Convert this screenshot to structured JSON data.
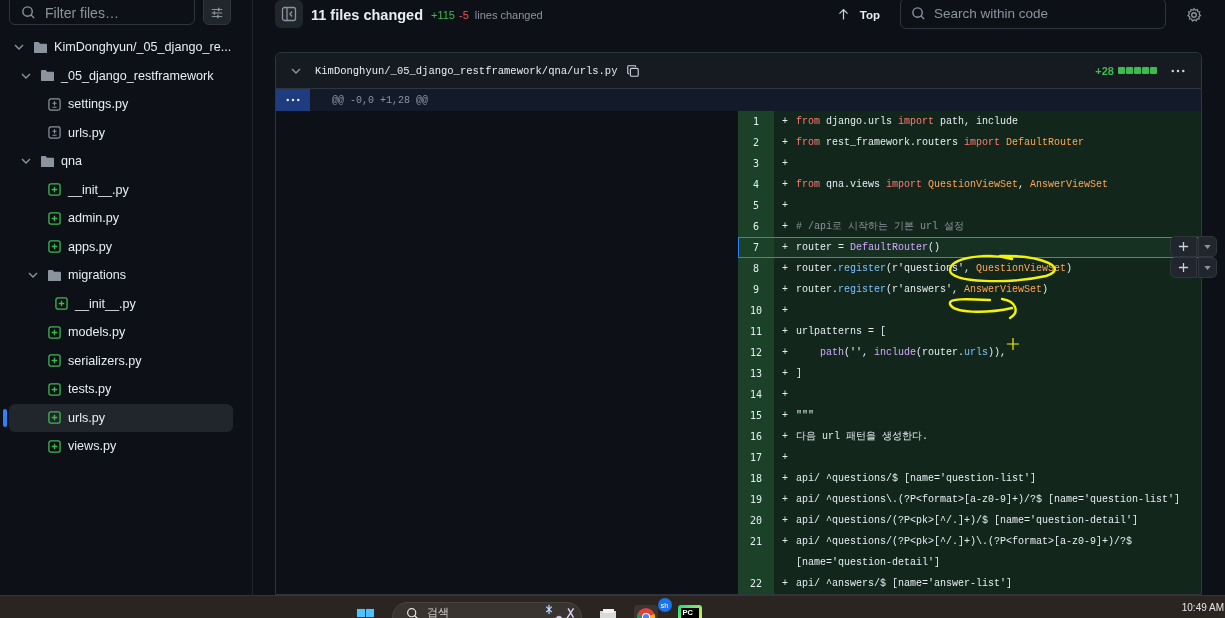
{
  "sidebar": {
    "filter_placeholder": "Filter files…",
    "tree": [
      {
        "kind": "folder",
        "name": "KimDonghyun/_05_django_re...",
        "expanded": true,
        "selected": false,
        "children": [
          {
            "kind": "folder",
            "name": "_05_django_restframework",
            "expanded": true,
            "selected": false,
            "children": [
              {
                "kind": "modified_file",
                "name": "settings.py",
                "selected": false
              },
              {
                "kind": "modified_file",
                "name": "urls.py",
                "selected": false
              }
            ]
          },
          {
            "kind": "folder",
            "name": "qna",
            "expanded": true,
            "selected": false,
            "children": [
              {
                "kind": "added_file",
                "name": "__init__.py",
                "selected": false
              },
              {
                "kind": "added_file",
                "name": "admin.py",
                "selected": false
              },
              {
                "kind": "added_file",
                "name": "apps.py",
                "selected": false
              },
              {
                "kind": "folder",
                "name": "migrations",
                "expanded": true,
                "selected": false,
                "children": [
                  {
                    "kind": "added_file",
                    "name": "__init__.py",
                    "selected": false
                  }
                ]
              },
              {
                "kind": "added_file",
                "name": "models.py",
                "selected": false
              },
              {
                "kind": "added_file",
                "name": "serializers.py",
                "selected": false
              },
              {
                "kind": "added_file",
                "name": "tests.py",
                "selected": false
              },
              {
                "kind": "added_file",
                "name": "urls.py",
                "selected": true
              },
              {
                "kind": "added_file",
                "name": "views.py",
                "selected": false
              }
            ]
          }
        ]
      }
    ]
  },
  "header": {
    "title": "11 files changed",
    "additions": "+115",
    "deletions": "-5",
    "note": "lines changed",
    "top_label": "Top",
    "search_placeholder": "Search within code"
  },
  "file": {
    "path": "KimDonghyun/_05_django_restframework/qna/urls.py",
    "expanded": true,
    "additions": "+28",
    "hunk": "@@ -0,0 +1,28 @@",
    "lines": [
      {
        "number": "1",
        "kind": "add",
        "marker": "+",
        "selected": false,
        "comment_button": false,
        "tokens": [
          {
            "kind": "kw",
            "text": "from"
          },
          {
            "kind": "txt",
            "text": " django.urls "
          },
          {
            "kind": "kw",
            "text": "import"
          },
          {
            "kind": "txt",
            "text": " path, include"
          }
        ]
      },
      {
        "number": "2",
        "kind": "add",
        "marker": "+",
        "selected": false,
        "comment_button": false,
        "tokens": [
          {
            "kind": "kw",
            "text": "from"
          },
          {
            "kind": "txt",
            "text": " rest_framework.routers "
          },
          {
            "kind": "kw",
            "text": "import"
          },
          {
            "kind": "cls",
            "text": " DefaultRouter"
          }
        ]
      },
      {
        "number": "3",
        "kind": "add",
        "marker": "+",
        "selected": false,
        "comment_button": false
      },
      {
        "number": "4",
        "kind": "add",
        "marker": "+",
        "selected": false,
        "comment_button": false,
        "tokens": [
          {
            "kind": "kw",
            "text": "from"
          },
          {
            "kind": "txt",
            "text": " qna.views "
          },
          {
            "kind": "kw",
            "text": "import"
          },
          {
            "kind": "cls",
            "text": " QuestionViewSet"
          },
          {
            "kind": "txt",
            "text": ", "
          },
          {
            "kind": "cls",
            "text": "AnswerViewSet"
          }
        ]
      },
      {
        "number": "5",
        "kind": "add",
        "marker": "+",
        "selected": false,
        "comment_button": false
      },
      {
        "number": "6",
        "kind": "add",
        "marker": "+",
        "selected": false,
        "comment_button": false,
        "tokens": [
          {
            "kind": "cmt",
            "text": "# /api로 시작하는 기본 url 설정"
          }
        ]
      },
      {
        "number": "7",
        "kind": "add",
        "marker": "+",
        "selected": true,
        "comment_button": true,
        "tokens": [
          {
            "kind": "txt",
            "text": "router = "
          },
          {
            "kind": "fn",
            "text": "DefaultRouter"
          },
          {
            "kind": "txt",
            "text": "()"
          }
        ]
      },
      {
        "number": "8",
        "kind": "add",
        "marker": "+",
        "selected": false,
        "comment_button": true,
        "tokens": [
          {
            "kind": "txt",
            "text": "router."
          },
          {
            "kind": "attr",
            "text": "register"
          },
          {
            "kind": "txt",
            "text": "(r'questions', "
          },
          {
            "kind": "cls",
            "text": "QuestionViewSet"
          },
          {
            "kind": "txt",
            "text": ")"
          }
        ]
      },
      {
        "number": "9",
        "kind": "add",
        "marker": "+",
        "selected": false,
        "comment_button": false,
        "tokens": [
          {
            "kind": "txt",
            "text": "router."
          },
          {
            "kind": "attr",
            "text": "register"
          },
          {
            "kind": "txt",
            "text": "(r'answers', "
          },
          {
            "kind": "cls",
            "text": "AnswerViewSet"
          },
          {
            "kind": "txt",
            "text": ")"
          }
        ]
      },
      {
        "number": "10",
        "kind": "add",
        "marker": "+",
        "selected": false,
        "comment_button": false
      },
      {
        "number": "11",
        "kind": "add",
        "marker": "+",
        "selected": false,
        "comment_button": false,
        "tokens": [
          {
            "kind": "txt",
            "text": "urlpatterns = ["
          }
        ]
      },
      {
        "number": "12",
        "kind": "add",
        "marker": "+",
        "selected": false,
        "comment_button": false,
        "tokens": [
          {
            "kind": "fn",
            "text": "    path"
          },
          {
            "kind": "txt",
            "text": "('', "
          },
          {
            "kind": "fn",
            "text": "include"
          },
          {
            "kind": "txt",
            "text": "(router."
          },
          {
            "kind": "attr",
            "text": "urls"
          },
          {
            "kind": "txt",
            "text": ")),"
          }
        ]
      },
      {
        "number": "13",
        "kind": "add",
        "marker": "+",
        "selected": false,
        "comment_button": false,
        "tokens": [
          {
            "kind": "txt",
            "text": "]"
          }
        ]
      },
      {
        "number": "14",
        "kind": "add",
        "marker": "+",
        "selected": false,
        "comment_button": false
      },
      {
        "number": "15",
        "kind": "add",
        "marker": "+",
        "selected": false,
        "comment_button": false,
        "tokens": [
          {
            "kind": "txt",
            "text": "\"\"\""
          }
        ]
      },
      {
        "number": "16",
        "kind": "add",
        "marker": "+",
        "selected": false,
        "comment_button": false,
        "tokens": [
          {
            "kind": "txt",
            "text": "다음 url 패턴을 생성한다."
          }
        ]
      },
      {
        "number": "17",
        "kind": "add",
        "marker": "+",
        "selected": false,
        "comment_button": false
      },
      {
        "number": "18",
        "kind": "add",
        "marker": "+",
        "selected": false,
        "comment_button": false,
        "tokens": [
          {
            "kind": "txt",
            "text": "api/ ^questions/$ [name='question-list']"
          }
        ]
      },
      {
        "number": "19",
        "kind": "add",
        "marker": "+",
        "selected": false,
        "comment_button": false,
        "tokens": [
          {
            "kind": "txt",
            "text": "api/ ^questions\\.(?P<format>[a-z0-9]+)/?$ [name='question-list']"
          }
        ]
      },
      {
        "number": "20",
        "kind": "add",
        "marker": "+",
        "selected": false,
        "comment_button": false,
        "tokens": [
          {
            "kind": "txt",
            "text": "api/ ^questions/(?P<pk>[^/.]+)/$ [name='question-detail']"
          }
        ]
      },
      {
        "number": "21",
        "kind": "add",
        "marker": "+",
        "selected": false,
        "comment_button": false,
        "tokens": [
          {
            "kind": "txt",
            "text": "api/ ^questions/(?P<pk>[^/.]+)\\.(?P<format>[a-z0-9]+)/?$ [name='question-detail']"
          }
        ]
      },
      {
        "number": "22",
        "kind": "add",
        "marker": "+",
        "selected": false,
        "comment_button": false,
        "tokens": [
          {
            "kind": "txt",
            "text": "api/ ^answers/$ [name='answer-list']"
          }
        ]
      }
    ]
  },
  "taskbar": {
    "search_placeholder": "검색",
    "apps": [
      {
        "kind": "files"
      },
      {
        "kind": "browser",
        "badge": "sh"
      },
      {
        "kind": "ide",
        "label": "PC"
      }
    ],
    "clock": "10:49 AM"
  }
}
